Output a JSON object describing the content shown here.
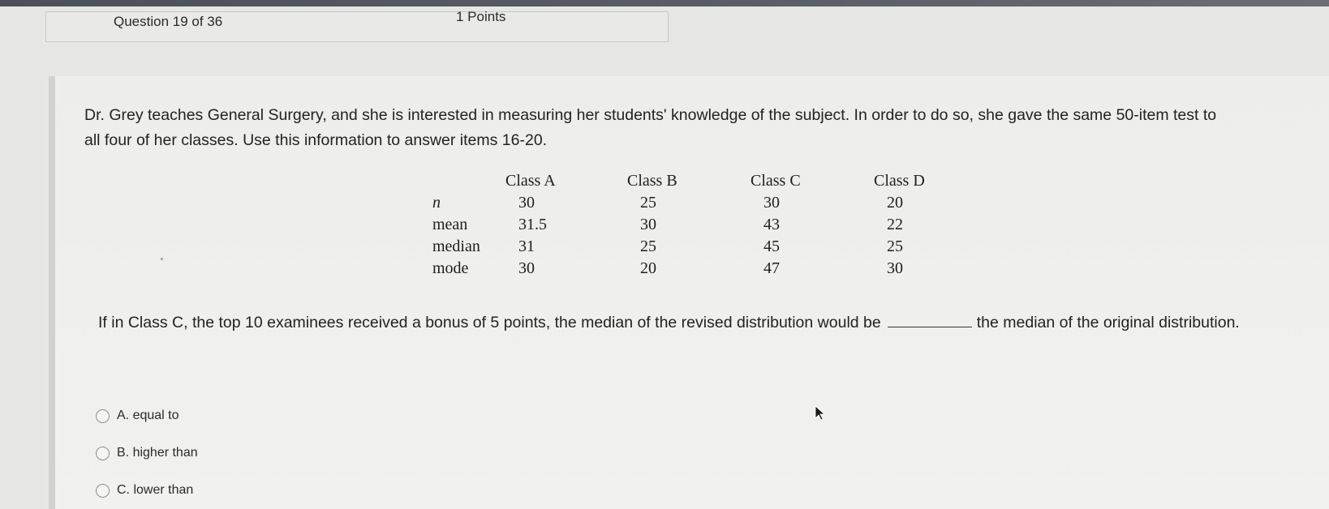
{
  "header": {
    "question_label": "Question 19 of 36",
    "points_label": "1 Points"
  },
  "question": {
    "stem": "Dr. Grey teaches General Surgery, and she is interested in measuring her students' knowledge of the subject. In order to do so, she gave the same 50-item test to all four of her classes. Use this information to answer items 16-20.",
    "prompt_before_blank": "If in Class C, the top 10 examinees received a bonus of 5 points, the median of the revised distribution would be",
    "prompt_after_blank": "the median of the original distribution."
  },
  "table": {
    "headers": [
      "",
      "Class A",
      "Class B",
      "Class C",
      "Class D"
    ],
    "rows": [
      {
        "label": "n",
        "values": [
          "30",
          "25",
          "30",
          "20"
        ]
      },
      {
        "label": "mean",
        "values": [
          "31.5",
          "30",
          "43",
          "22"
        ]
      },
      {
        "label": "median",
        "values": [
          "31",
          "25",
          "45",
          "25"
        ]
      },
      {
        "label": "mode",
        "values": [
          "30",
          "20",
          "47",
          "30"
        ]
      }
    ]
  },
  "choices": [
    {
      "label": "A. equal to"
    },
    {
      "label": "B. higher than"
    },
    {
      "label": "C. lower than"
    }
  ],
  "icons": {
    "radio": "radio-unselected-icon",
    "cursor": "mouse-pointer-icon"
  }
}
